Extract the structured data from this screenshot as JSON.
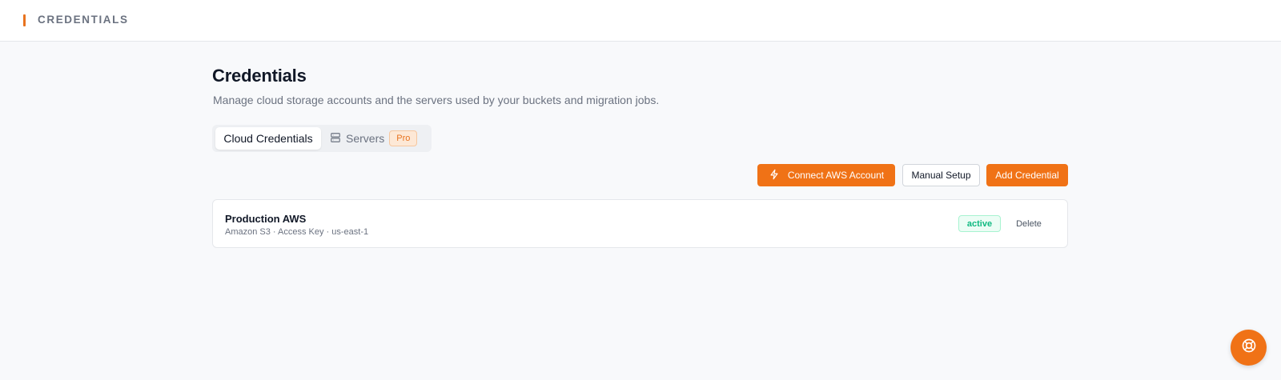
{
  "topbar": {
    "breadcrumb": "CREDENTIALS"
  },
  "page": {
    "title": "Credentials",
    "subtitle": "Manage cloud storage accounts and the servers used by your buckets and migration jobs."
  },
  "tabs": {
    "cloud_credentials": "Cloud Credentials",
    "servers": "Servers",
    "servers_badge": "Pro"
  },
  "actions": {
    "connect_aws": "Connect AWS Account",
    "manual_setup": "Manual Setup",
    "add_credential": "Add Credential"
  },
  "credentials": [
    {
      "name": "Production AWS",
      "meta": "Amazon S3 · Access Key · us-east-1",
      "status": "active",
      "delete_label": "Delete"
    }
  ],
  "colors": {
    "accent": "#f07216",
    "active_green": "#10b981"
  },
  "icons": {
    "connect": "lightning-bolt-icon",
    "servers": "server-icon",
    "help": "lifebuoy-icon"
  }
}
